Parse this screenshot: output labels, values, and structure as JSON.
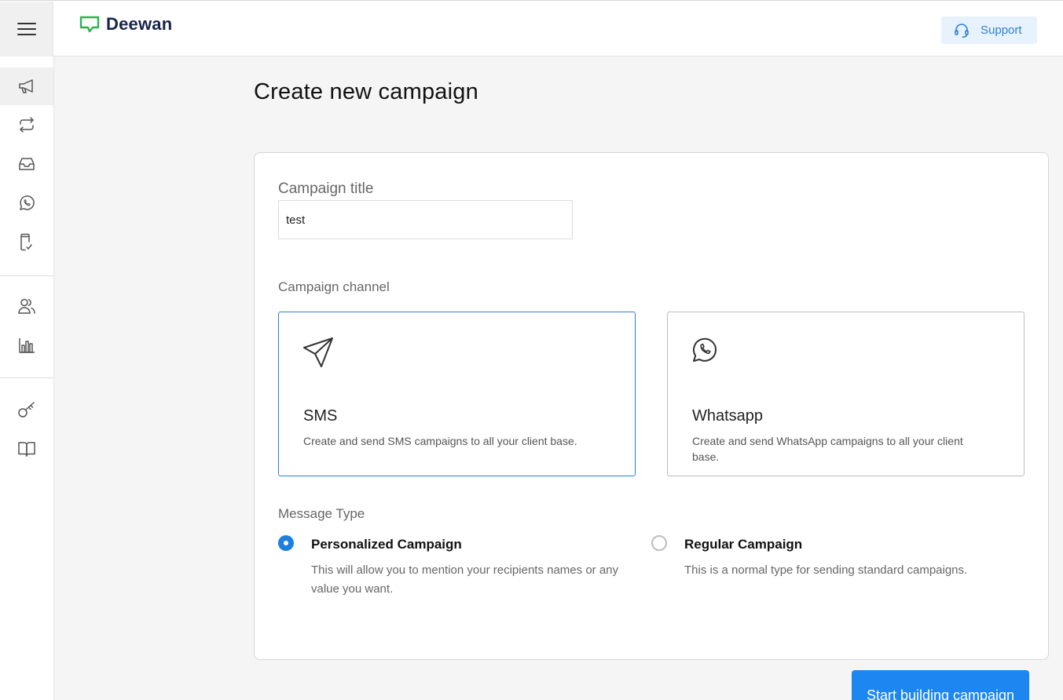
{
  "app": {
    "brand": "Deewan"
  },
  "header": {
    "support_label": "Support"
  },
  "sidebar": {
    "items": [
      {
        "icon": "megaphone-icon",
        "active": true
      },
      {
        "icon": "repeat-icon"
      },
      {
        "icon": "inbox-icon"
      },
      {
        "icon": "whatsapp-icon"
      },
      {
        "icon": "phone-check-icon"
      },
      {
        "icon": "users-icon"
      },
      {
        "icon": "bar-chart-icon"
      },
      {
        "icon": "key-icon"
      },
      {
        "icon": "book-icon"
      }
    ]
  },
  "page": {
    "title": "Create new campaign"
  },
  "form": {
    "title_label": "Campaign title",
    "title_value": "test",
    "channel_label": "Campaign channel",
    "channels": [
      {
        "title": "SMS",
        "description": "Create and send SMS campaigns to all your client base.",
        "selected": true,
        "icon": "send-icon"
      },
      {
        "title": "Whatsapp",
        "description": "Create and send WhatsApp campaigns to all your client base.",
        "selected": false,
        "icon": "whatsapp-icon"
      }
    ],
    "message_type_label": "Message Type",
    "message_types": [
      {
        "title": "Personalized Campaign",
        "description": "This will allow you to mention your recipients names or any value you want.",
        "selected": true
      },
      {
        "title": "Regular Campaign",
        "description": "This is a normal type for sending standard campaigns.",
        "selected": false
      }
    ]
  },
  "actions": {
    "start_label": "Start building campaign"
  },
  "colors": {
    "accent": "#1e86f0",
    "brand_green": "#2bb34a",
    "brand_text": "#17254a",
    "support_bg": "#e8f2fd"
  }
}
